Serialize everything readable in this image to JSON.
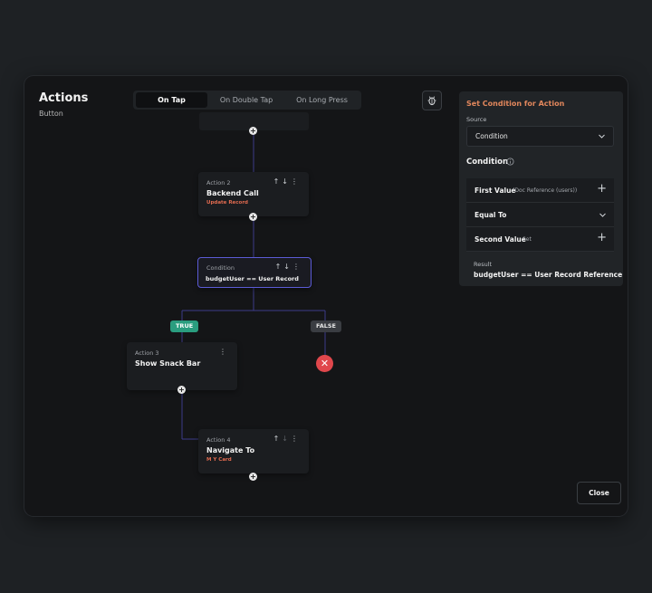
{
  "header": {
    "title": "Actions",
    "subtitle": "Button"
  },
  "tabs": [
    {
      "label": "On Tap",
      "active": true
    },
    {
      "label": "On Double Tap",
      "active": false
    },
    {
      "label": "On Long Press",
      "active": false
    }
  ],
  "flow": {
    "action2": {
      "label": "Action 2",
      "title": "Backend Call",
      "sub": "Update Record"
    },
    "condition": {
      "label": "Condition",
      "expr": "budgetUser == User Record"
    },
    "true_label": "TRUE",
    "false_label": "FALSE",
    "action3": {
      "label": "Action 3",
      "title": "Show Snack Bar"
    },
    "action4": {
      "label": "Action 4",
      "title": "Navigate To",
      "sub": "M Y Card"
    }
  },
  "panel": {
    "title": "Set Condition for Action",
    "source_label": "Source",
    "source_value": "Condition",
    "condition_heading": "Condition",
    "first_value_label": "First Value",
    "first_value_hint": "(Doc Reference (users))",
    "operator": "Equal To",
    "second_value_label": "Second Value",
    "second_value_hint": "Set",
    "result_label": "Result",
    "result_value": "budgetUser == User Record Reference"
  },
  "footer": {
    "close_label": "Close"
  },
  "colors": {
    "accent_orange": "#e2875c",
    "condition_border": "#5b5bd6",
    "true_badge": "#2a9d7f",
    "false_icon": "#e0474c"
  }
}
